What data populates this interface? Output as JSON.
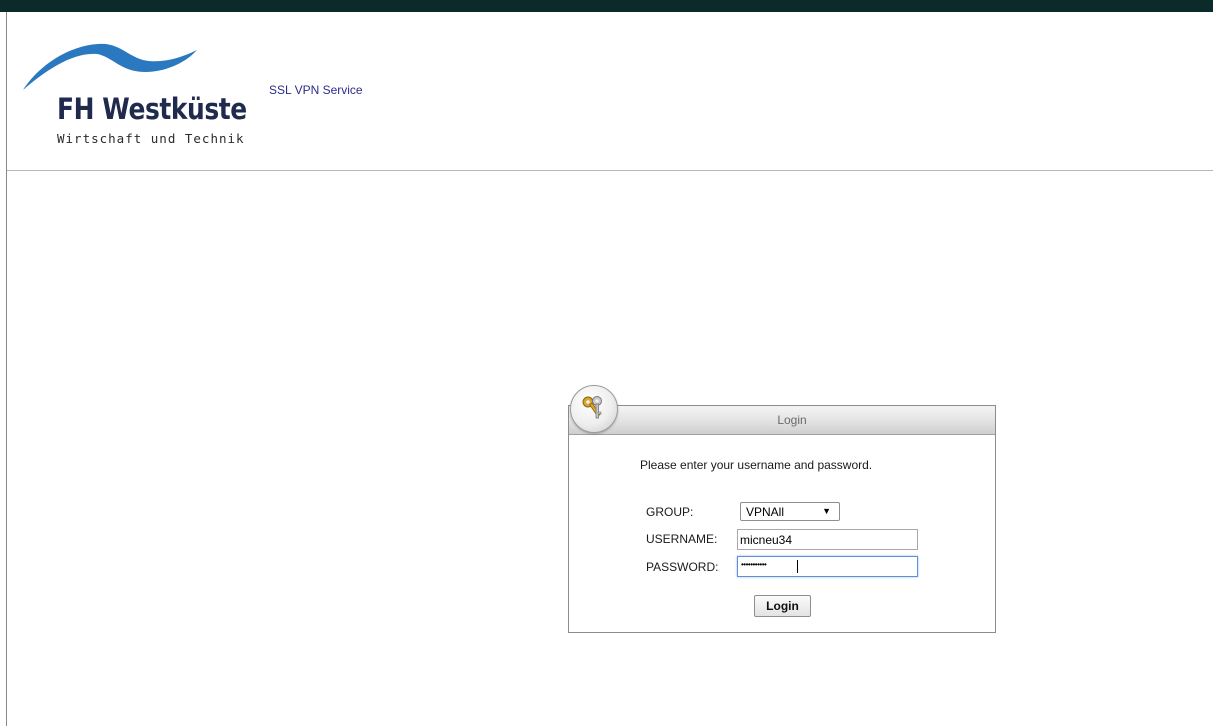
{
  "header": {
    "logo_name": "FH Westküste",
    "logo_tagline": "Wirtschaft und Technik",
    "service_title": "SSL VPN Service"
  },
  "login": {
    "panel_title": "Login",
    "prompt": "Please enter your username and password.",
    "group_label": "GROUP:",
    "group_value": "VPNAll",
    "username_label": "USERNAME:",
    "username_value": "micneu34",
    "password_label": "PASSWORD:",
    "password_mask": "•••••••••••",
    "submit_label": "Login"
  },
  "icons": {
    "select_arrow": "▼",
    "panel_icon": "keys-icon",
    "logo_mark": "wave-icon"
  },
  "colors": {
    "top_bar": "#0c2a2a",
    "logo_wave": "#2a79c0",
    "logo_text": "#1f2a4d",
    "service_title": "#2c2c8a",
    "focus_border": "#5e90d6"
  }
}
